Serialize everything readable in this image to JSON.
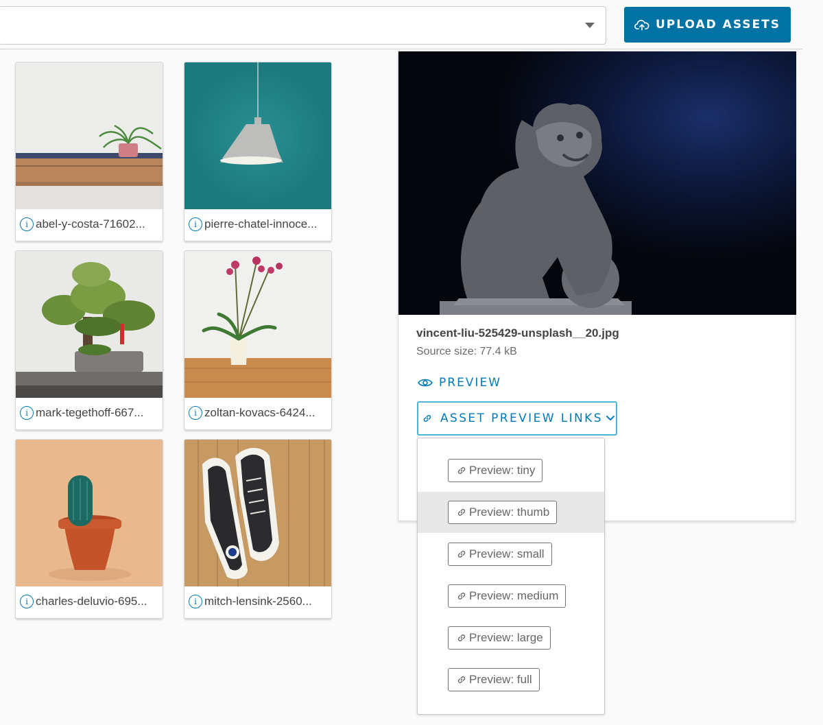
{
  "toolbar": {
    "upload_label": "UPLOAD ASSETS"
  },
  "assets": [
    {
      "caption": "abel-y-costa-71602...",
      "image": "plant on wooden shelf"
    },
    {
      "caption": "pierre-chatel-innoce...",
      "image": "pendant lamp on teal wall"
    },
    {
      "caption": "mark-tegethoff-667...",
      "image": "bonsai tree"
    },
    {
      "caption": "zoltan-kovacs-6424...",
      "image": "orchid in vase"
    },
    {
      "caption": "charles-deluvio-695...",
      "image": "cactus in terracotta pot"
    },
    {
      "caption": "mitch-lensink-2560...",
      "image": "sneakers on wood floor"
    }
  ],
  "detail": {
    "file_name": "vincent-liu-525429-unsplash__20.jpg",
    "source_size": "Source size: 77.4 kB",
    "preview_label": "PREVIEW",
    "asset_preview_links_label": "ASSET PREVIEW LINKS"
  },
  "preview_links": [
    {
      "label": "Preview: tiny",
      "highlighted": false
    },
    {
      "label": "Preview: thumb",
      "highlighted": true
    },
    {
      "label": "Preview: small",
      "highlighted": false
    },
    {
      "label": "Preview: medium",
      "highlighted": false
    },
    {
      "label": "Preview: large",
      "highlighted": false
    },
    {
      "label": "Preview: full",
      "highlighted": false
    }
  ],
  "colors": {
    "accent": "#0072a3",
    "link": "#0079b8",
    "focus_border": "#4cb3d6",
    "highlight": "#e8e8e8"
  },
  "icons": {
    "upload": "cloud-upload-icon",
    "info": "info-icon",
    "preview": "eye-icon",
    "links": "link-icon",
    "dropdown": "chevron-down-icon"
  }
}
